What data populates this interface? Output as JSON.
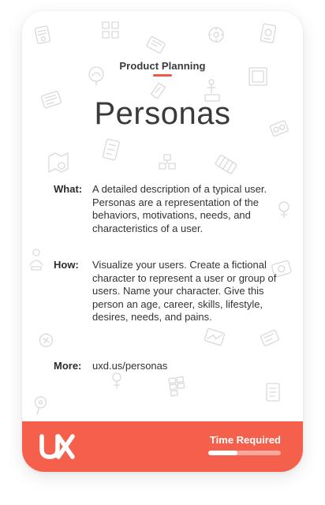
{
  "card": {
    "category": "Product Planning",
    "title": "Personas",
    "what_label": "What:",
    "what_text": "A detailed description of a typical user. Personas are a representation of the behaviors, motivations, needs, and characteristics of a user.",
    "how_label": "How:",
    "how_text": "Visualize your users. Create a fictional character to represent a user or group of users. Name your character. Give this person an age, career, skills, lifestyle, desires, needs, and pains.",
    "more_label": "More:",
    "more_link": "uxd.us/personas"
  },
  "footer": {
    "logo_text": "UX",
    "time_label": "Time Required",
    "time_fraction": 0.4
  },
  "colors": {
    "accent": "#f4604c",
    "underline": "#f05a46",
    "text": "#3a3a3a",
    "doodle": "#d9d9d9"
  },
  "icons": [
    "decorative-doodle-icon",
    "ux-logo-icon"
  ]
}
